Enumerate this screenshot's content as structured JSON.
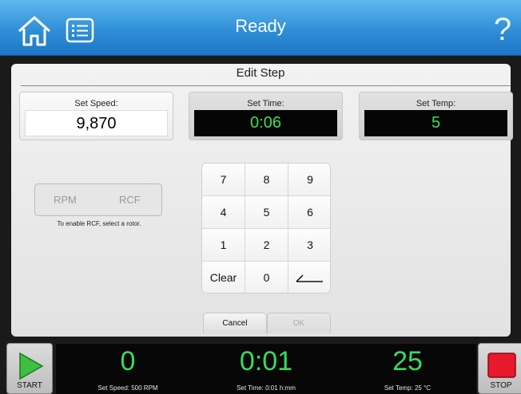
{
  "header": {
    "title": "Ready",
    "help_glyph": "?"
  },
  "edit_step": {
    "title": "Edit Step",
    "speed": {
      "label": "Set Speed:",
      "value": "9,870"
    },
    "time": {
      "label": "Set Time:",
      "value": "0:06"
    },
    "temp": {
      "label": "Set Temp:",
      "value": "5"
    }
  },
  "units": {
    "rpm": "RPM",
    "rcf": "RCF",
    "note": "To enable RCF, select a rotor."
  },
  "keypad": {
    "keys": [
      "7",
      "8",
      "9",
      "4",
      "5",
      "6",
      "1",
      "2",
      "3",
      "Clear",
      "0"
    ]
  },
  "actions": {
    "cancel": "Cancel",
    "ok": "OK"
  },
  "bottom": {
    "start": "START",
    "stop": "STOP",
    "speed_value": "0",
    "speed_sub": "Set Speed: 500 RPM",
    "time_value": "0:01",
    "time_sub": "Set Time: 0:01 h:mm",
    "temp_value": "25",
    "temp_sub": "Set Temp: 25 °C"
  },
  "colors": {
    "header_blue": "#2f8fd7",
    "display_green": "#39db5e",
    "stop_red": "#e8192c",
    "start_green": "#3fbf3f"
  }
}
